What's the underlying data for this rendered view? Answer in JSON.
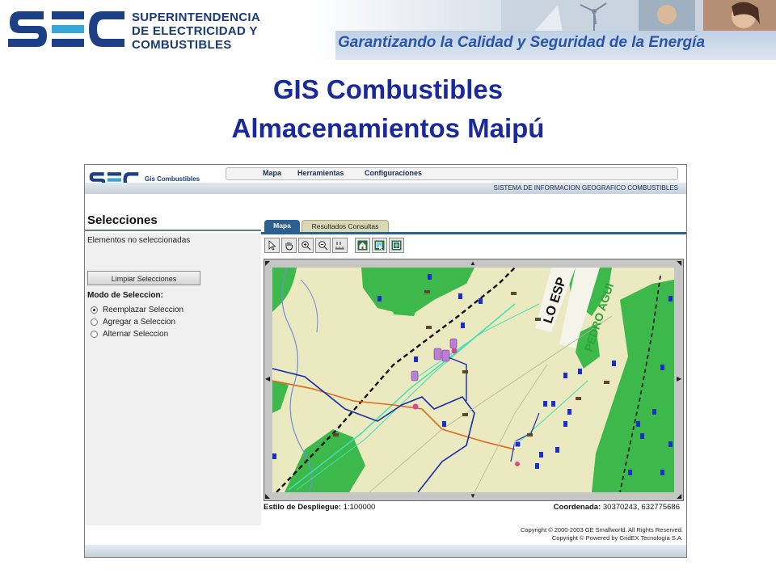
{
  "header": {
    "org_line1": "SUPERINTENDENCIA",
    "org_line2": "DE ELECTRICIDAD Y",
    "org_line3": "COMBUSTIBLES",
    "slogan": "Garantizando la Calidad y Seguridad de la Energía",
    "logo_icon": "sec-logo-icon"
  },
  "page": {
    "title_line1": "GIS Combustibles",
    "title_line2": "Almacenamientos Maipú"
  },
  "app": {
    "name": "Gis Combustibles",
    "system_label": "SISTEMA DE INFORMACION GEOGRAFICO COMBUSTIBLES",
    "menu": [
      "Mapa",
      "Herramientas",
      "Configuraciones"
    ],
    "tabs": [
      {
        "label": "Mapa",
        "active": true
      },
      {
        "label": "Resultados Consultas",
        "active": false
      }
    ],
    "tools": [
      "arrow-select-icon",
      "pan-hand-icon",
      "zoom-in-icon",
      "zoom-out-icon",
      "measure-icon",
      "home-icon",
      "select-area-icon",
      "full-extent-icon"
    ]
  },
  "selecciones": {
    "title": "Selecciones",
    "status": "Elementos no seleccionadas",
    "clear_button": "Limpiar Selecciones",
    "mode_label": "Modo de Seleccion:",
    "modes": [
      {
        "label": "Reemplazar Seleccion",
        "checked": true
      },
      {
        "label": "Agregar a Seleccion",
        "checked": false
      },
      {
        "label": "Alternar Seleccion",
        "checked": false
      }
    ]
  },
  "map": {
    "labels": [
      "LO ESP",
      "PEDRO AGUI"
    ],
    "colors": {
      "park": "#3db84a",
      "base": "#ebe9c0",
      "road_orange": "#e0691c",
      "road_blue": "#1a2ea8",
      "water": "#6b8fe0",
      "pipeline": "#3ee0b5"
    }
  },
  "footer": {
    "display_style_label": "Estilo de Despliegue:",
    "display_style_value": "1:100000",
    "coord_label": "Coordenada:",
    "coord_value": "30370243, 632775686",
    "copyright1": "Copyright © 2000-2003 GE Smallworld. All Rights Reserved.",
    "copyright2": "Copyright © Powered by GridEX Tecnología S.A."
  }
}
